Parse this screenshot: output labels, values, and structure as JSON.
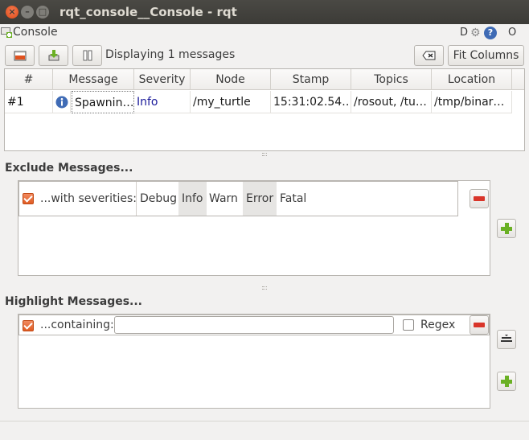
{
  "window": {
    "title": "rqt_console__Console - rqt"
  },
  "dock": {
    "title": "Console",
    "d_label": "D",
    "help_label": "?",
    "o_label": "O"
  },
  "toolbar": {
    "status": "Displaying 1 messages",
    "fit_columns": "Fit Columns"
  },
  "table": {
    "headers": [
      "#",
      "Message",
      "Severity",
      "Node",
      "Stamp",
      "Topics",
      "Location"
    ],
    "rows": [
      {
        "num": "#1",
        "message": "Spawnin…",
        "severity": "Info",
        "node": "/my_turtle",
        "stamp": "15:31:02.54…",
        "topics": "/rosout, /tu…",
        "location": "/tmp/binar…"
      }
    ]
  },
  "exclude": {
    "title": "Exclude Messages...",
    "label": "...with severities:",
    "severities": [
      {
        "name": "Debug",
        "selected": false
      },
      {
        "name": "Info",
        "selected": true
      },
      {
        "name": "Warn",
        "selected": false
      },
      {
        "name": "Error",
        "selected": true
      },
      {
        "name": "Fatal",
        "selected": false
      }
    ]
  },
  "highlight": {
    "title": "Highlight Messages...",
    "label": "...containing:",
    "value": "",
    "regex_label": "Regex",
    "regex_checked": false
  },
  "colors": {
    "accent": "#e05b22",
    "info_text": "#1a1a9a",
    "titlebar": "#3c3b37"
  }
}
